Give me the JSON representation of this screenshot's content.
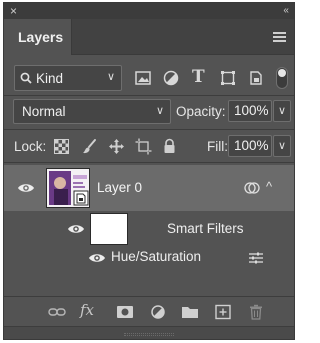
{
  "panel": {
    "close_glyph": "×",
    "collapse_glyph": "‹‹",
    "tab_label": "Layers",
    "menu_icon": "panel-menu-icon"
  },
  "filter": {
    "kind_label": "Kind",
    "kind_icon": "search-icon",
    "icons": [
      "pixel-filter-icon",
      "adjustment-filter-icon",
      "type-filter-icon",
      "shape-filter-icon",
      "smart-object-filter-icon"
    ],
    "type_glyph": "T"
  },
  "blend": {
    "mode": "Normal",
    "opacity_label": "Opacity:",
    "opacity_value": "100%"
  },
  "lock": {
    "label": "Lock:",
    "icons": [
      "lock-transparent-icon",
      "lock-image-icon",
      "lock-position-icon",
      "lock-artboard-icon",
      "lock-all-icon"
    ],
    "fill_label": "Fill:",
    "fill_value": "100%"
  },
  "layers": [
    {
      "name": "Layer 0",
      "visible": true,
      "selected": true,
      "smart_filters": {
        "label": "Smart Filters",
        "visible": true,
        "filters": [
          {
            "name": "Hue/Saturation",
            "visible": true
          }
        ]
      }
    }
  ],
  "bottom_bar": {
    "icons": [
      "link-layers-icon",
      "fx-icon",
      "add-mask-icon",
      "new-adjustment-layer-icon",
      "new-group-folder-icon",
      "new-layer-icon",
      "delete-layer-icon"
    ],
    "fx_label": "fx"
  },
  "colors": {
    "panel_bg": "#535353",
    "selected_row_bg": "#6b6b6b",
    "text": "#e6e6e6"
  }
}
